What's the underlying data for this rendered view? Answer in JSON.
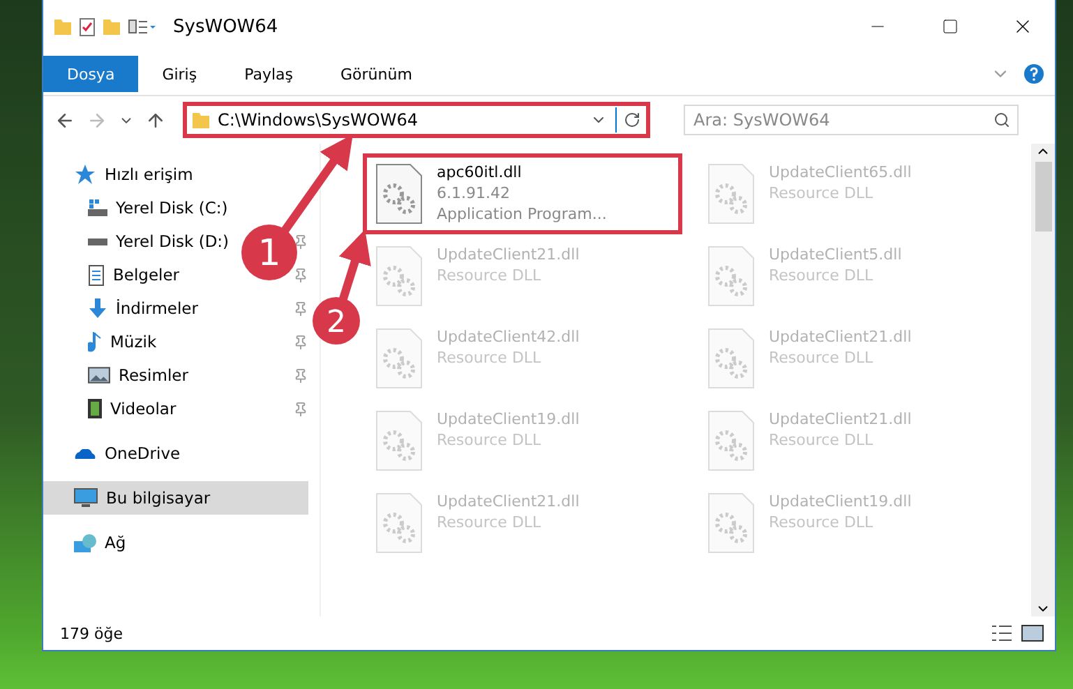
{
  "window": {
    "title": "SysWOW64"
  },
  "ribbon_tabs": [
    {
      "label": "Dosya",
      "selected": true
    },
    {
      "label": "Giriş",
      "selected": false
    },
    {
      "label": "Paylaş",
      "selected": false
    },
    {
      "label": "Görünüm",
      "selected": false
    }
  ],
  "address_bar": {
    "path": "C:\\Windows\\SysWOW64",
    "highlighted": true
  },
  "search": {
    "placeholder": "Ara: SysWOW64"
  },
  "sidebar": {
    "items": [
      {
        "label": "Hızlı erişim",
        "kind": "star",
        "selected": false,
        "children": [
          {
            "label": "Yerel Disk (C:)",
            "kind": "drive-os",
            "pinned": false,
            "selected": false
          },
          {
            "label": "Yerel Disk (D:)",
            "kind": "drive",
            "pinned": true,
            "selected": false
          },
          {
            "label": "Belgeler",
            "kind": "document",
            "pinned": true,
            "selected": false
          },
          {
            "label": "İndirmeler",
            "kind": "download",
            "pinned": true,
            "selected": false
          },
          {
            "label": "Müzik",
            "kind": "music",
            "pinned": true,
            "selected": false
          },
          {
            "label": "Resimler",
            "kind": "picture",
            "pinned": true,
            "selected": false
          },
          {
            "label": "Videolar",
            "kind": "video",
            "pinned": true,
            "selected": false
          }
        ]
      },
      {
        "label": "OneDrive",
        "kind": "cloud",
        "selected": false
      },
      {
        "label": "Bu bilgisayar",
        "kind": "computer",
        "selected": true
      },
      {
        "label": "Ağ",
        "kind": "network",
        "selected": false
      }
    ]
  },
  "files": [
    {
      "name": "apc60itl.dll",
      "lines": [
        "6.1.91.42",
        "Application Program..."
      ],
      "highlighted": true,
      "faded": false
    },
    {
      "name": "UpdateClient65.dll",
      "lines": [
        "Resource DLL"
      ],
      "highlighted": false,
      "faded": true
    },
    {
      "name": "UpdateClient21.dll",
      "lines": [
        "Resource DLL"
      ],
      "highlighted": false,
      "faded": true
    },
    {
      "name": "UpdateClient5.dll",
      "lines": [
        "Resource DLL"
      ],
      "highlighted": false,
      "faded": true
    },
    {
      "name": "UpdateClient42.dll",
      "lines": [
        "Resource DLL"
      ],
      "highlighted": false,
      "faded": true
    },
    {
      "name": "UpdateClient21.dll",
      "lines": [
        "Resource DLL"
      ],
      "highlighted": false,
      "faded": true
    },
    {
      "name": "UpdateClient19.dll",
      "lines": [
        "Resource DLL"
      ],
      "highlighted": false,
      "faded": true
    },
    {
      "name": "UpdateClient21.dll",
      "lines": [
        "Resource DLL"
      ],
      "highlighted": false,
      "faded": true
    },
    {
      "name": "UpdateClient21.dll",
      "lines": [
        "Resource DLL"
      ],
      "highlighted": false,
      "faded": true
    },
    {
      "name": "UpdateClient19.dll",
      "lines": [
        "Resource DLL"
      ],
      "highlighted": false,
      "faded": true
    }
  ],
  "callouts": [
    {
      "number": "1"
    },
    {
      "number": "2"
    }
  ],
  "status_bar": {
    "count": "179 öğe"
  }
}
